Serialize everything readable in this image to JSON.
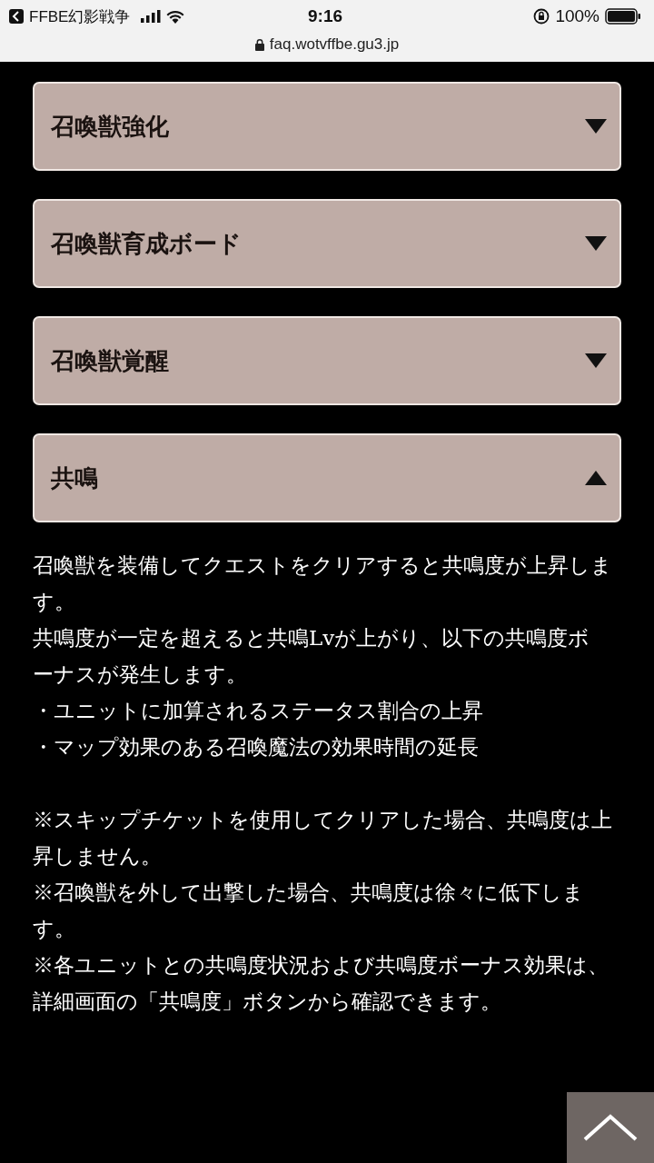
{
  "status_bar": {
    "back_app": "FFBE幻影戦争",
    "time": "9:16",
    "battery": "100%"
  },
  "url_bar": {
    "url": "faq.wotvffbe.gu3.jp"
  },
  "accordion": [
    {
      "title": "召喚獣強化",
      "expanded": false
    },
    {
      "title": "召喚獣育成ボード",
      "expanded": false
    },
    {
      "title": "召喚獣覚醒",
      "expanded": false
    },
    {
      "title": "共鳴",
      "expanded": true
    }
  ],
  "answer": [
    [
      "召喚獣を装備してクエストをクリアすると共鳴度が上昇しま",
      "す。",
      "共鳴度が一定を超えると共鳴Lvが上がり、以下の共鳴度ボ",
      "ーナスが発生します。",
      "・ユニットに加算されるステータス割合の上昇",
      "・マップ効果のある召喚魔法の効果時間の延長"
    ],
    [
      "※スキップチケットを使用してクリアした場合、共鳴度は上",
      "昇しません。",
      "※召喚獣を外して出撃した場合、共鳴度は徐々に低下しま",
      "す。",
      "※各ユニットとの共鳴度状況および共鳴度ボーナス効果は、",
      "詳細画面の「共鳴度」ボタンから確認できます。"
    ]
  ]
}
